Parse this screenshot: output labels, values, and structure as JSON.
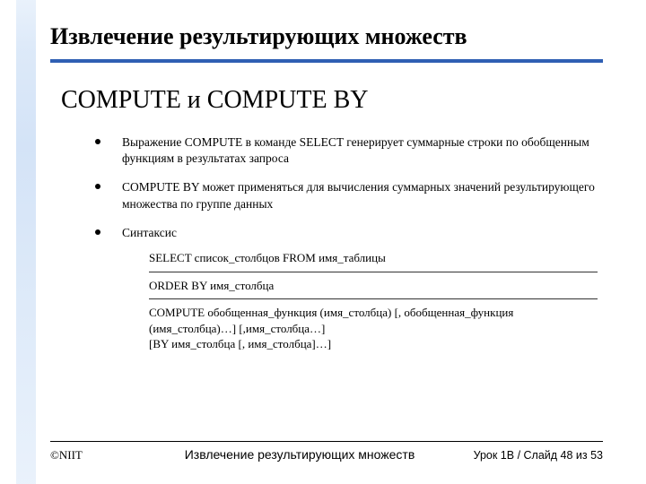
{
  "header": {
    "title": "Извлечение результирующих множеств",
    "subtitle": "COMPUTE и COMPUTE BY"
  },
  "bullets": [
    "Выражение COMPUTE в команде SELECT генерирует суммарные строки по обобщенным функциям в результатах запроса",
    "COMPUTE BY может применяться для вычисления суммарных значений результирующего множества по группе данных",
    "Синтаксис"
  ],
  "syntax": [
    "SELECT список_столбцов FROM имя_таблицы",
    "ORDER BY имя_столбца",
    "COMPUTE обобщенная_функция (имя_столбца)  [, обобщенная_функция (имя_столбца)…]            [,имя_столбца…]\n[BY имя_столбца [, имя_столбца]…]"
  ],
  "footer": {
    "left": "©NIIT",
    "center": "Извлечение результирующих множеств",
    "right": "Урок 1B / Слайд 48 из 53"
  }
}
